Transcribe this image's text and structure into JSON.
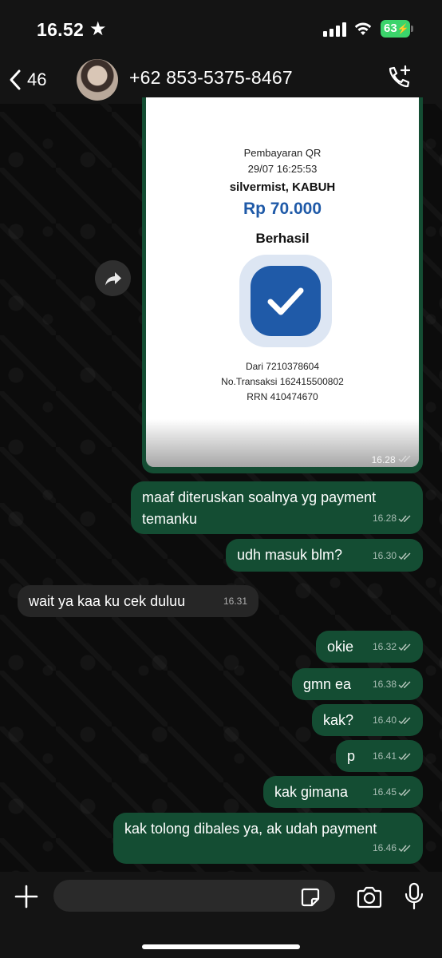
{
  "status_bar": {
    "time": "16.52",
    "battery": "63"
  },
  "header": {
    "back_count": "46",
    "contact_name": "+62 853-5375-8467"
  },
  "media_message": {
    "receipt": {
      "title": "Pembayaran QR",
      "datetime": "29/07 16:25:53",
      "merchant": "silvermist, KABUH",
      "amount": "Rp 70.000",
      "status": "Berhasil",
      "from": "Dari 7210378604",
      "transaction": "No.Transaksi 162415500802",
      "rrn": "RRN 410474670"
    },
    "time": "16.28"
  },
  "messages": [
    {
      "dir": "out",
      "text": "maaf diteruskan soalnya yg payment temanku",
      "time": "16.28"
    },
    {
      "dir": "out",
      "text": "udh masuk blm?",
      "time": "16.30"
    },
    {
      "dir": "in",
      "text": "wait ya kaa ku cek duluu",
      "time": "16.31"
    },
    {
      "dir": "out",
      "text": "okie",
      "time": "16.32"
    },
    {
      "dir": "out",
      "text": "gmn ea",
      "time": "16.38"
    },
    {
      "dir": "out",
      "text": "kak?",
      "time": "16.40"
    },
    {
      "dir": "out",
      "text": "p",
      "time": "16.41"
    },
    {
      "dir": "out",
      "text": "kak gimana",
      "time": "16.45"
    },
    {
      "dir": "out",
      "text": "kak tolong dibales ya, ak udah payment",
      "time": "16.46"
    }
  ],
  "colors": {
    "outgoing_bubble": "#144d33",
    "incoming_bubble": "#262626",
    "accent_green": "#3bd46b",
    "receipt_blue": "#1f5aa8"
  },
  "icons": [
    "star-icon",
    "signal-icon",
    "wifi-icon",
    "battery-icon",
    "chevron-left-icon",
    "phone-add-icon",
    "forward-icon",
    "checkmark-icon",
    "plus-icon",
    "sticker-icon",
    "camera-icon",
    "microphone-icon"
  ]
}
